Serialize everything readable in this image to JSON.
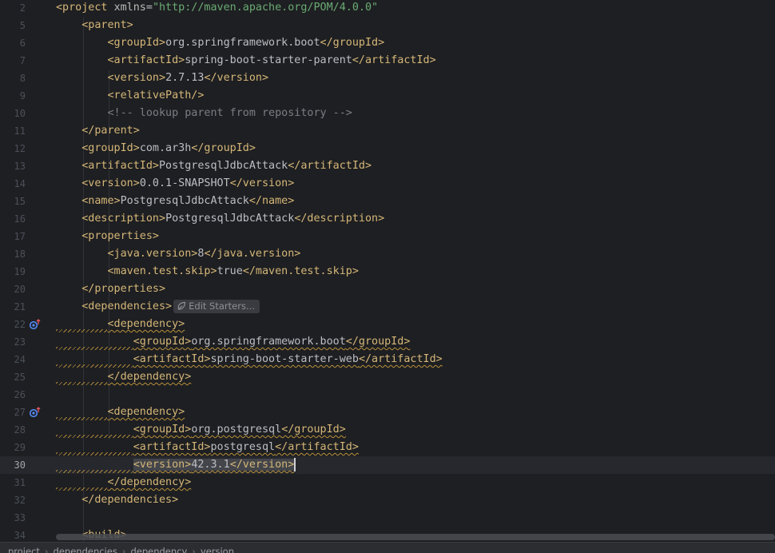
{
  "editor": {
    "current_line": "30",
    "inlay_hint": "Edit Starters...",
    "gutter_icons": [
      "spring-bean-gutter-icon",
      "spring-bean-gutter-icon"
    ],
    "lines": [
      {
        "num": "2",
        "indent": 0,
        "parts": [
          [
            "tag",
            "<project "
          ],
          [
            "attr",
            "xmlns"
          ],
          [
            "txt",
            "="
          ],
          [
            "str",
            "\"http://maven.apache.org/POM/4.0.0\""
          ]
        ]
      },
      {
        "num": "5",
        "indent": 1,
        "parts": [
          [
            "tag",
            "<parent>"
          ]
        ]
      },
      {
        "num": "6",
        "indent": 2,
        "parts": [
          [
            "tag",
            "<groupId>"
          ],
          [
            "txt",
            "org.springframework.boot"
          ],
          [
            "tag",
            "</groupId>"
          ]
        ]
      },
      {
        "num": "7",
        "indent": 2,
        "parts": [
          [
            "tag",
            "<artifactId>"
          ],
          [
            "txt",
            "spring-boot-starter-parent"
          ],
          [
            "tag",
            "</artifactId>"
          ]
        ]
      },
      {
        "num": "8",
        "indent": 2,
        "parts": [
          [
            "tag",
            "<version>"
          ],
          [
            "txt",
            "2.7.13"
          ],
          [
            "tag",
            "</version>"
          ]
        ]
      },
      {
        "num": "9",
        "indent": 2,
        "parts": [
          [
            "tag",
            "<relativePath/>"
          ]
        ]
      },
      {
        "num": "10",
        "indent": 2,
        "parts": [
          [
            "cmt",
            "<!-- lookup parent from repository -->"
          ]
        ]
      },
      {
        "num": "11",
        "indent": 1,
        "parts": [
          [
            "tag",
            "</parent>"
          ]
        ]
      },
      {
        "num": "12",
        "indent": 1,
        "parts": [
          [
            "tag",
            "<groupId>"
          ],
          [
            "txt",
            "com.ar3h"
          ],
          [
            "tag",
            "</groupId>"
          ]
        ]
      },
      {
        "num": "13",
        "indent": 1,
        "parts": [
          [
            "tag",
            "<artifactId>"
          ],
          [
            "txt",
            "PostgresqlJdbcAttack"
          ],
          [
            "tag",
            "</artifactId>"
          ]
        ]
      },
      {
        "num": "14",
        "indent": 1,
        "parts": [
          [
            "tag",
            "<version>"
          ],
          [
            "txt",
            "0.0.1-SNAPSHOT"
          ],
          [
            "tag",
            "</version>"
          ]
        ]
      },
      {
        "num": "15",
        "indent": 1,
        "parts": [
          [
            "tag",
            "<name>"
          ],
          [
            "txt",
            "PostgresqlJdbcAttack"
          ],
          [
            "tag",
            "</name>"
          ]
        ]
      },
      {
        "num": "16",
        "indent": 1,
        "parts": [
          [
            "tag",
            "<description>"
          ],
          [
            "txt",
            "PostgresqlJdbcAttack"
          ],
          [
            "tag",
            "</description>"
          ]
        ]
      },
      {
        "num": "17",
        "indent": 1,
        "parts": [
          [
            "tag",
            "<properties>"
          ]
        ]
      },
      {
        "num": "18",
        "indent": 2,
        "parts": [
          [
            "tag",
            "<java.version>"
          ],
          [
            "txt",
            "8"
          ],
          [
            "tag",
            "</java.version>"
          ]
        ]
      },
      {
        "num": "19",
        "indent": 2,
        "parts": [
          [
            "tag",
            "<maven.test.skip>"
          ],
          [
            "txt",
            "true"
          ],
          [
            "tag",
            "</maven.test.skip>"
          ]
        ]
      },
      {
        "num": "20",
        "indent": 1,
        "parts": [
          [
            "tag",
            "</properties>"
          ]
        ]
      },
      {
        "num": "21",
        "indent": 1,
        "parts": [
          [
            "tag",
            "<dependencies>"
          ]
        ],
        "inlay": true
      },
      {
        "num": "22",
        "indent": 2,
        "icon": 0,
        "squig": true,
        "parts": [
          [
            "tag",
            "<dependency>"
          ]
        ]
      },
      {
        "num": "23",
        "indent": 3,
        "squig": true,
        "parts": [
          [
            "tag",
            "<groupId>"
          ],
          [
            "txt",
            "org.springframework.boot"
          ],
          [
            "tag",
            "</groupId>"
          ]
        ]
      },
      {
        "num": "24",
        "indent": 3,
        "squig": true,
        "parts": [
          [
            "tag",
            "<artifactId>"
          ],
          [
            "txt",
            "spring-boot-starter-web"
          ],
          [
            "tag",
            "</artifactId>"
          ]
        ]
      },
      {
        "num": "25",
        "indent": 2,
        "squig": true,
        "parts": [
          [
            "tag",
            "</dependency>"
          ]
        ]
      },
      {
        "num": "26",
        "indent": 0,
        "parts": []
      },
      {
        "num": "27",
        "indent": 2,
        "icon": 1,
        "squig": true,
        "parts": [
          [
            "tag",
            "<dependency>"
          ]
        ]
      },
      {
        "num": "28",
        "indent": 3,
        "squig": true,
        "parts": [
          [
            "tag",
            "<groupId>"
          ],
          [
            "txt",
            "org.postgresql"
          ],
          [
            "tag",
            "</groupId>"
          ]
        ]
      },
      {
        "num": "29",
        "indent": 3,
        "squig": true,
        "parts": [
          [
            "tag",
            "<artifactId>"
          ],
          [
            "txt",
            "postgresql"
          ],
          [
            "tag",
            "</artifactId>"
          ]
        ]
      },
      {
        "num": "30",
        "indent": 3,
        "squig": true,
        "current": true,
        "parts": [
          [
            "tag",
            "<version>"
          ],
          [
            "txt",
            "42.3.1"
          ],
          [
            "tag",
            "</version>"
          ]
        ]
      },
      {
        "num": "31",
        "indent": 2,
        "squig": true,
        "parts": [
          [
            "tag",
            "</dependency>"
          ]
        ]
      },
      {
        "num": "32",
        "indent": 1,
        "parts": [
          [
            "tag",
            "</dependencies>"
          ]
        ]
      },
      {
        "num": "33",
        "indent": 0,
        "parts": []
      },
      {
        "num": "34",
        "indent": 1,
        "parts": [
          [
            "tag",
            "<build>"
          ]
        ]
      }
    ]
  },
  "statusbar": {
    "breadcrumbs": [
      "project",
      "dependencies",
      "dependency",
      "version"
    ]
  },
  "colors": {
    "background": "#1e1f22",
    "tag": "#d5b778",
    "string": "#6aab73",
    "text": "#bcbec4",
    "comment": "#7a7e85",
    "warning_underline": "#b9913b"
  }
}
